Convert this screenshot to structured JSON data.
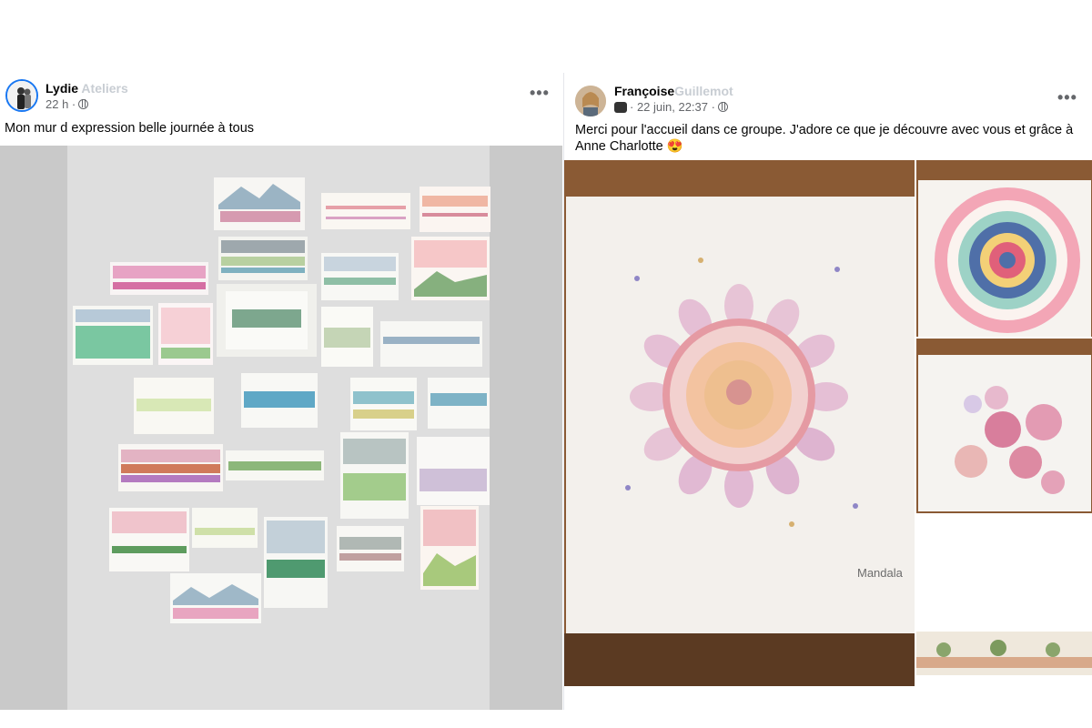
{
  "post1": {
    "author_first": "Lydie",
    "author_last": "Ateliers",
    "time": "22 h ·",
    "body": "Mon mur d expression  belle journée  à  tous",
    "icons": {
      "avatar": "profile-avatar",
      "privacy": "globe-icon",
      "more": "more-options-icon"
    },
    "more_label": "•••"
  },
  "post2": {
    "author_first": "Françoise",
    "author_last": "Guillemot",
    "time": "· 22 juin, 22:37 ·",
    "body": "Merci pour l'accueil dans ce groupe. J'adore ce que je découvre avec vous et grâce à Anne Charlotte 😍",
    "photo_caption": "Mandala",
    "icons": {
      "avatar": "profile-avatar",
      "group_badge": "group-badge-icon",
      "privacy": "globe-icon",
      "more": "more-options-icon"
    },
    "more_label": "•••"
  },
  "colors": {
    "accent": "#1877f2",
    "secondary_text": "#65676b",
    "wall": "#d8d8d8"
  }
}
